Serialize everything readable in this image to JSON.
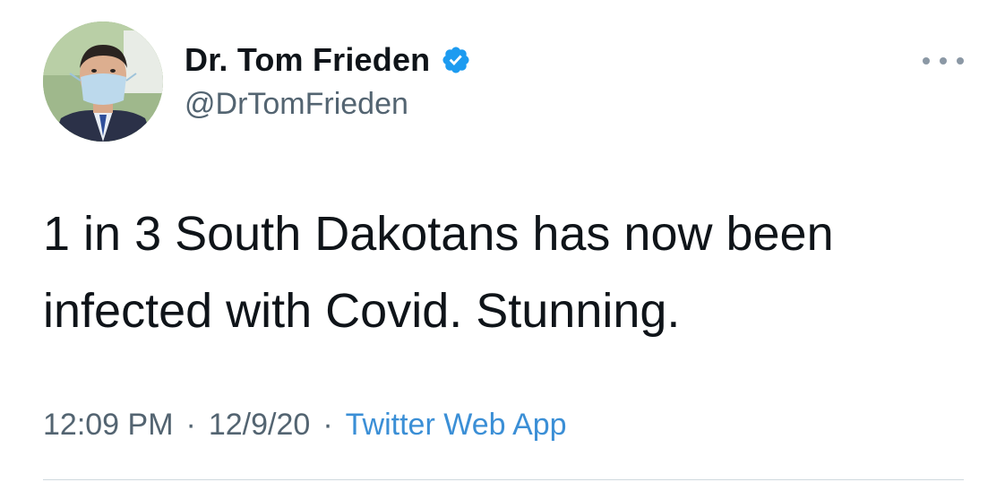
{
  "tweet": {
    "author": {
      "display_name": "Dr. Tom Frieden",
      "handle": "@DrTomFrieden",
      "verified": true,
      "avatar_icon": "profile-photo"
    },
    "text": "1 in 3 South Dakotans has now been\ninfected with Covid. Stunning.",
    "meta": {
      "time": "12:09 PM",
      "separator": "·",
      "date": "12/9/20",
      "source": "Twitter Web App"
    },
    "more_icon": "more-horizontal-icon"
  },
  "colors": {
    "text": "#0f1419",
    "secondary": "#536471",
    "link": "#3b8fd6",
    "verified": "#1d9bf0",
    "divider": "#cfd9de"
  }
}
